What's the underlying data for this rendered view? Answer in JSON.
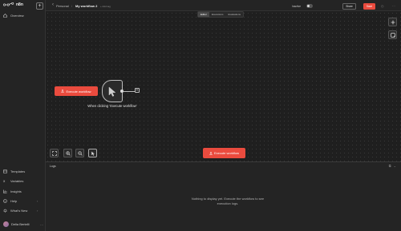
{
  "app": {
    "logo_text": "n8n"
  },
  "sidebar": {
    "items": [
      {
        "label": "Overview"
      }
    ],
    "bottom_items": [
      {
        "label": "Templates"
      },
      {
        "label": "Variables"
      },
      {
        "label": "Insights"
      },
      {
        "label": "Help"
      },
      {
        "label": "What's New"
      }
    ],
    "user_name": "Delia Bertelli"
  },
  "header": {
    "breadcrumb_root": "Personal",
    "breadcrumb_sep": "/",
    "workflow_title": "My workflow 2",
    "add_tag": "+ Add tag",
    "inactive_label": "Inactive",
    "share_label": "Share",
    "save_label": "Save"
  },
  "tabs": [
    {
      "label": "Editor",
      "active": true
    },
    {
      "label": "Executions",
      "active": false
    },
    {
      "label": "Evaluations",
      "active": false
    }
  ],
  "canvas": {
    "execute_button_left": "Execute workflow",
    "node_label": "When clicking ‘Execute workflow’",
    "execute_button_main": "Execute workflow"
  },
  "logs": {
    "title": "Logs",
    "empty_message": "Nothing to display yet. Execute the workflow to see execution logs."
  },
  "colors": {
    "accent": "#ea4b3e",
    "background": "#1f1f1f",
    "panel": "#242424"
  }
}
